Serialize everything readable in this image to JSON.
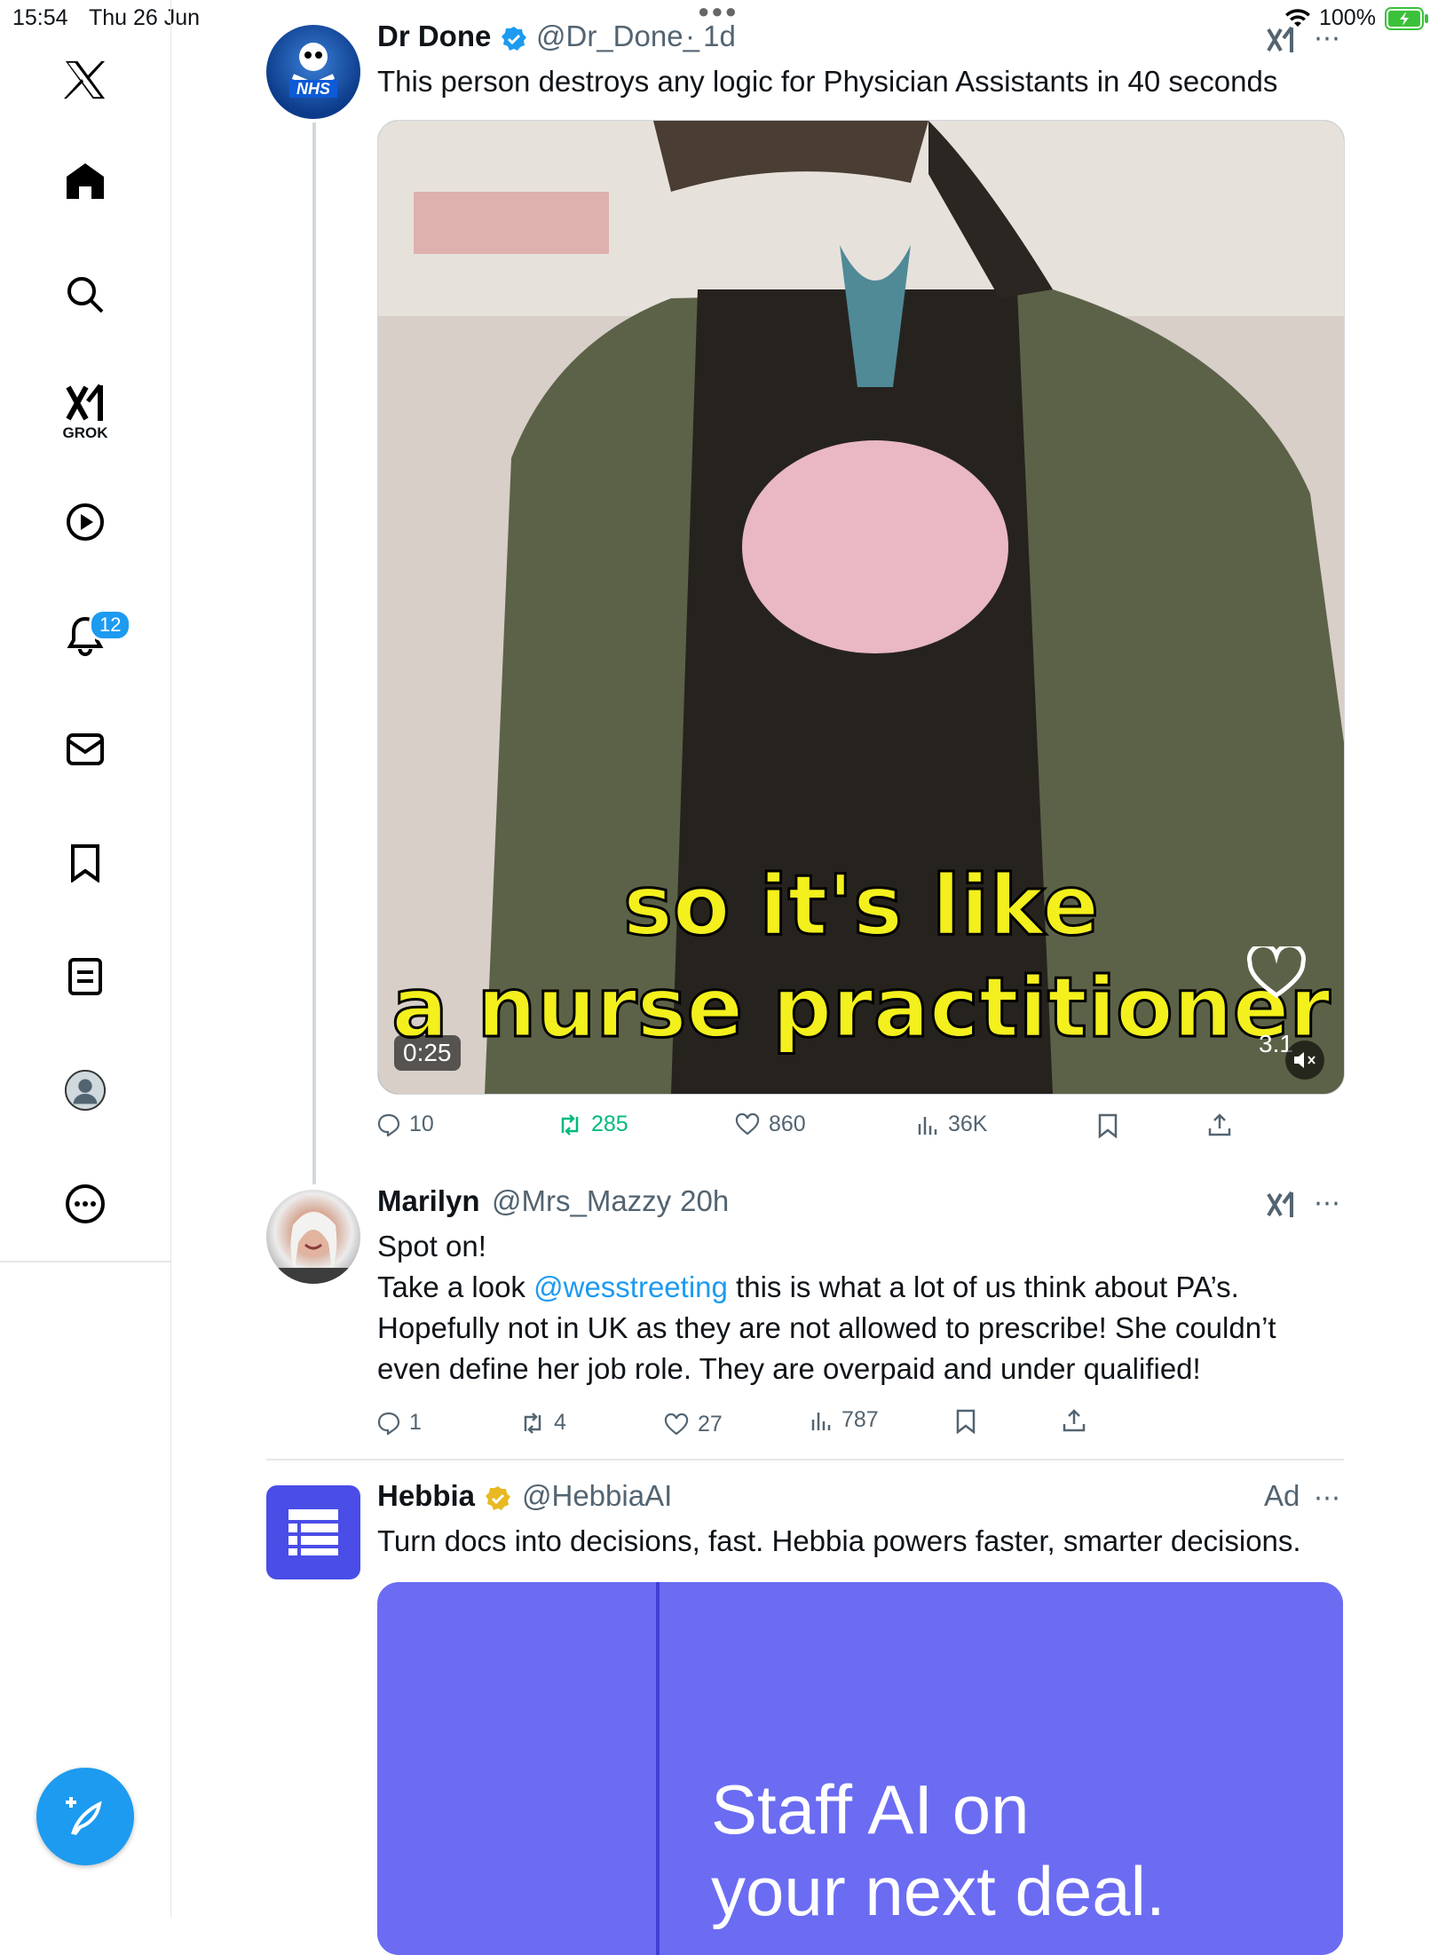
{
  "status_bar": {
    "time": "15:54",
    "date": "Thu 26 Jun",
    "battery": "100%"
  },
  "sidebar": {
    "items": [
      {
        "name": "x-logo-icon"
      },
      {
        "name": "home-icon"
      },
      {
        "name": "search-icon"
      },
      {
        "name": "grok-icon",
        "label": "GROK"
      },
      {
        "name": "video-icon"
      },
      {
        "name": "notifications-icon",
        "badge": "12"
      },
      {
        "name": "messages-icon"
      },
      {
        "name": "bookmarks-icon"
      },
      {
        "name": "lists-icon"
      },
      {
        "name": "profile-icon"
      },
      {
        "name": "more-icon"
      }
    ],
    "compose": "compose-icon"
  },
  "tweets": [
    {
      "author": "Dr Done",
      "handle": "@Dr_Done_",
      "time": "· 1d",
      "text": "This person destroys any logic for Physician Assistants in 40 seconds",
      "media": {
        "caption_line1": "so it's like",
        "caption_line2": "a nurse practitioner",
        "duration": "0:25",
        "overlay_count": "3.1"
      },
      "metrics": {
        "replies": "10",
        "reposts": "285",
        "likes": "860",
        "views": "36K"
      }
    },
    {
      "author": "Marilyn",
      "handle": "@Mrs_Mazzy",
      "time": "· 20h",
      "text_line1": "Spot on!",
      "text_pre": "Take a look ",
      "mention": "@wesstreeting",
      "text_post": " this is what a lot of us think about PA’s.",
      "text_rest": "Hopefully not in UK as they are not allowed to prescribe! She couldn’t even define her job role. They are overpaid and under qualified!",
      "metrics": {
        "replies": "1",
        "reposts": "4",
        "likes": "27",
        "views": "787"
      }
    },
    {
      "author": "Hebbia",
      "handle": "@HebbiaAI",
      "ad_label": "Ad",
      "text": "Turn docs into decisions, fast. Hebbia powers faster, smarter decisions.",
      "ad_headline_1": "Staff AI on",
      "ad_headline_2": "your next deal."
    }
  ],
  "colors": {
    "accent": "#1d9bf0",
    "repost": "#00ba7c",
    "gold": "#e8b923",
    "ad_bg": "#6b6cf2"
  }
}
